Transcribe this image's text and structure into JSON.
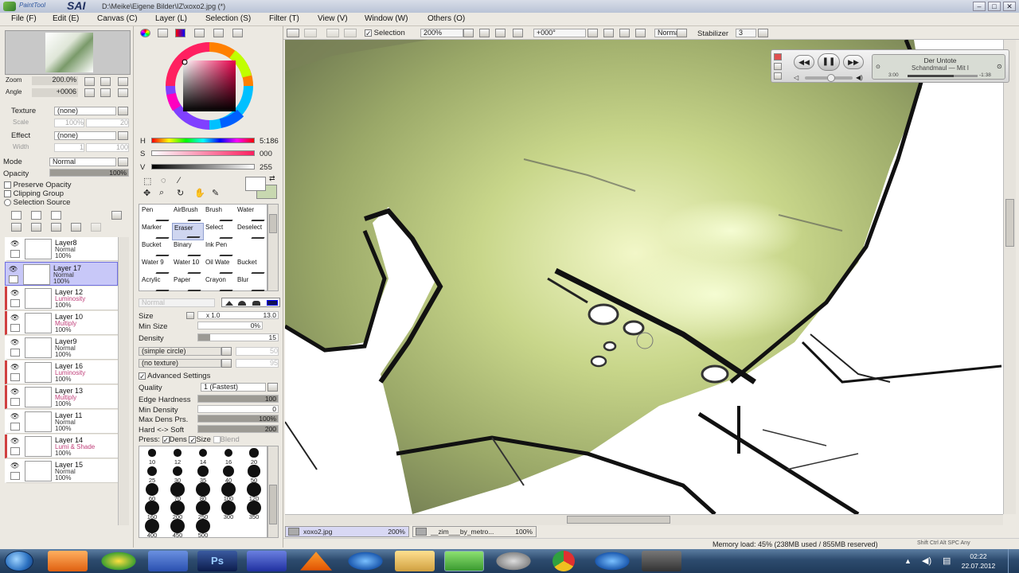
{
  "app": {
    "title": "PaintTool SAI",
    "logo_small": "PaintTool",
    "logo_big": "SAI",
    "file_path": "D:\\Meike\\Eigene Bilder\\IZ\\xoxo2.jpg (*)"
  },
  "menu": [
    "File (F)",
    "Edit (E)",
    "Canvas (C)",
    "Layer (L)",
    "Selection (S)",
    "Filter (T)",
    "View (V)",
    "Window (W)",
    "Others (O)"
  ],
  "navigator": {
    "zoom_label": "Zoom",
    "zoom_value": "200.0%",
    "angle_label": "Angle",
    "angle_value": "+0006"
  },
  "texture": {
    "label": "Texture",
    "value": "(none)",
    "scale_label": "Scale",
    "scale_value": "100%",
    "scale_num": "20"
  },
  "effect": {
    "label": "Effect",
    "value": "(none)",
    "width_label": "Width",
    "width_value": "1",
    "width_num": "100"
  },
  "mode": {
    "label": "Mode",
    "value": "Normal",
    "opacity_label": "Opacity",
    "opacity_value": "100%",
    "opacity_level": 1.0
  },
  "options": {
    "preserve_opacity": "Preserve Opacity",
    "clipping_group": "Clipping Group",
    "selection_source": "Selection Source"
  },
  "layers": [
    {
      "name": "Layer8",
      "mode": "Normal",
      "opacity": "100%",
      "selected": false,
      "red": false
    },
    {
      "name": "Layer 17",
      "mode": "Normal",
      "opacity": "100%",
      "selected": true,
      "red": false
    },
    {
      "name": "Layer 12",
      "mode": "Luminosity",
      "opacity": "100%",
      "selected": false,
      "red": true
    },
    {
      "name": "Layer 10",
      "mode": "Multiply",
      "opacity": "100%",
      "selected": false,
      "red": true
    },
    {
      "name": "Layer9",
      "mode": "Normal",
      "opacity": "100%",
      "selected": false,
      "red": false
    },
    {
      "name": "Layer 16",
      "mode": "Luminosity",
      "opacity": "100%",
      "selected": false,
      "red": true
    },
    {
      "name": "Layer 13",
      "mode": "Multiply",
      "opacity": "100%",
      "selected": false,
      "red": true
    },
    {
      "name": "Layer 11",
      "mode": "Normal",
      "opacity": "100%",
      "selected": false,
      "red": false
    },
    {
      "name": "Layer 14",
      "mode": "Lumi & Shade",
      "opacity": "100%",
      "selected": false,
      "red": true
    },
    {
      "name": "Layer 15",
      "mode": "Normal",
      "opacity": "100%",
      "selected": false,
      "red": false
    }
  ],
  "color": {
    "h_label": "H",
    "h_value": "5:186",
    "s_label": "S",
    "s_value": "000",
    "v_label": "V",
    "v_value": "255",
    "fg": "#ffffff",
    "bg": "#c8d8b0"
  },
  "tools": [
    {
      "label": "Pen"
    },
    {
      "label": "AirBrush"
    },
    {
      "label": "Brush"
    },
    {
      "label": "Water"
    },
    {
      "label": "Marker"
    },
    {
      "label": "Eraser",
      "selected": true
    },
    {
      "label": "Select"
    },
    {
      "label": "Deselect"
    },
    {
      "label": "Bucket"
    },
    {
      "label": "Binary"
    },
    {
      "label": "Ink Pen"
    },
    {
      "label": ""
    },
    {
      "label": "Water 9"
    },
    {
      "label": "Water 10"
    },
    {
      "label": "Oil Wate"
    },
    {
      "label": "Bucket"
    },
    {
      "label": "Acrylic"
    },
    {
      "label": "Paper"
    },
    {
      "label": "Crayon"
    },
    {
      "label": "Blur"
    }
  ],
  "brush": {
    "blend_mode": "Normal",
    "size_label": "Size",
    "size_mult": "x 1.0",
    "size_value": "13.0",
    "minsize_label": "Min Size",
    "minsize_value": "0%",
    "density_label": "Density",
    "density_value": "15",
    "shape": "(simple circle)",
    "shape_num": "50",
    "texture": "(no texture)",
    "texture_num": "95",
    "advanced": "Advanced Settings",
    "quality_label": "Quality",
    "quality_value": "1 (Fastest)",
    "edge_label": "Edge Hardness",
    "edge_value": "100",
    "mindens_label": "Min Density",
    "mindens_value": "0",
    "maxdens_label": "Max Dens Prs.",
    "maxdens_value": "100%",
    "hardsoft_label": "Hard <-> Soft",
    "hardsoft_value": "200",
    "press_label": "Press:",
    "dens_label": "Dens",
    "sizep_label": "Size",
    "blend_label": "Blend"
  },
  "brush_sizes": [
    "10",
    "12",
    "14",
    "16",
    "20",
    "25",
    "30",
    "35",
    "40",
    "50",
    "60",
    "70",
    "80",
    "100",
    "120",
    "160",
    "200",
    "250",
    "300",
    "350",
    "400",
    "450",
    "500"
  ],
  "canvas_toolbar": {
    "selection_label": "Selection",
    "zoom": "200%",
    "angle": "+000°",
    "mode": "Normal",
    "stabilizer_label": "Stabilizer",
    "stabilizer_value": "3"
  },
  "media_player": {
    "artist": "Der Untote",
    "track": "Schandmaul — Mit I",
    "elapsed": "3:00",
    "remaining": "-1:38",
    "progress": 0.66
  },
  "tabs": [
    {
      "name": "xoxo2.jpg",
      "zoom": "200%"
    },
    {
      "name": "__zim___by_metro...",
      "zoom": "100%"
    }
  ],
  "status": {
    "memory": "Memory load: 45% (238MB used / 855MB reserved)",
    "keys": [
      "Shift",
      "Ctrl",
      "Alt",
      "SPC",
      "Any"
    ]
  },
  "taskbar": {
    "time": "02:22",
    "date": "22.07.2012",
    "ps_label": "Ps"
  }
}
